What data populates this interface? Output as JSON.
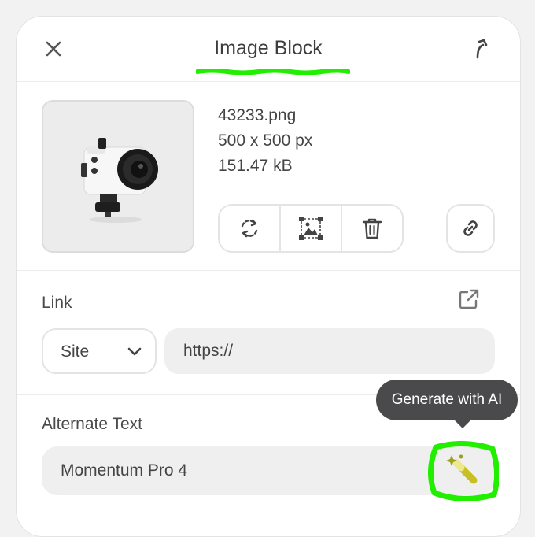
{
  "header": {
    "title": "Image Block"
  },
  "file": {
    "name": "43233.png",
    "dimensions": "500 x 500 px",
    "size": "151.47 kB"
  },
  "icons": {
    "close": "close-icon",
    "share": "share-icon",
    "replace": "replace-icon",
    "crop": "image-crop-icon",
    "delete": "trash-icon",
    "link": "link-icon",
    "external": "external-link-icon",
    "chevron": "chevron-down-icon",
    "ai": "magic-wand-icon"
  },
  "link": {
    "label": "Link",
    "type_value": "Site",
    "url_value": "https://"
  },
  "alt_text": {
    "label": "Alternate Text",
    "value": "Momentum Pro 4"
  },
  "tooltip": {
    "text": "Generate with AI"
  },
  "colors": {
    "highlight": "#22ee00",
    "tooltip_bg": "#4a4a4c",
    "field_bg": "#efefef"
  }
}
